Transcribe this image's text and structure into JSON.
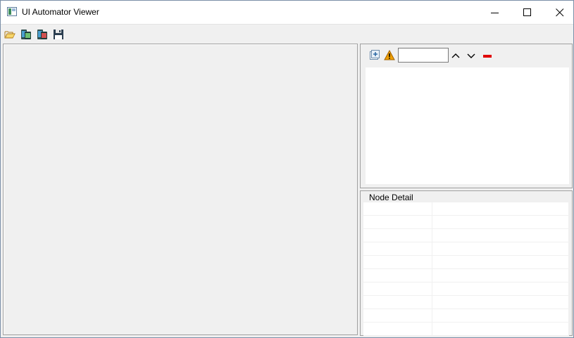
{
  "window": {
    "title": "UI Automator Viewer"
  },
  "toolbar": {
    "buttons": [
      {
        "name": "open-icon"
      },
      {
        "name": "device-screenshot-icon"
      },
      {
        "name": "device-screenshot-compressed-icon"
      },
      {
        "name": "save-icon"
      }
    ]
  },
  "tree": {
    "search": {
      "value": "",
      "placeholder": ""
    },
    "icons": [
      "expand-all-icon",
      "warning-icon",
      "chevron-up-icon",
      "chevron-down-icon",
      "clear-icon"
    ]
  },
  "node_detail": {
    "title": "Node Detail",
    "rows": [
      [
        "",
        ""
      ],
      [
        "",
        ""
      ],
      [
        "",
        ""
      ],
      [
        "",
        ""
      ],
      [
        "",
        ""
      ],
      [
        "",
        ""
      ],
      [
        "",
        ""
      ],
      [
        "",
        ""
      ],
      [
        "",
        ""
      ],
      [
        "",
        ""
      ]
    ]
  },
  "colors": {
    "warning": "#f0a000",
    "clear": "#e00000",
    "panel_border": "#a0a0a0",
    "background": "#f0f0f0"
  }
}
